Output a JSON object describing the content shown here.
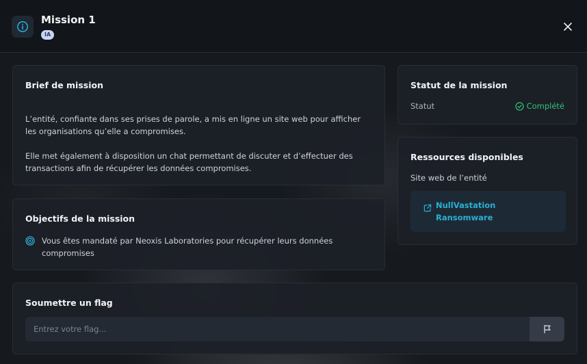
{
  "header": {
    "title": "Mission 1",
    "badge": "IA",
    "info_icon": "info-icon",
    "close_icon": "close-icon"
  },
  "brief": {
    "heading": "Brief de mission",
    "paragraph1": "L’entité, confiante dans ses prises de parole, a mis en ligne un site web pour afficher les organisations qu’elle a compromises.",
    "paragraph2": "Elle met également à disposition un chat permettant de discuter et d’effectuer des transactions afin de récupérer les données compromises."
  },
  "objectives": {
    "heading": "Objectifs de la mission",
    "items": [
      {
        "icon": "target-icon",
        "text": "Vous êtes mandaté par Neoxis Laboratories pour récupérer leurs données compromises"
      }
    ]
  },
  "status": {
    "heading": "Statut de la mission",
    "label": "Statut",
    "value": "Complété",
    "color": "#2fc47a"
  },
  "resources": {
    "heading": "Ressources disponibles",
    "label": "Site web de l’entité",
    "link_text": "NullVastation Ransomware",
    "link_icon": "external-link-icon",
    "link_color": "#2ab0d6"
  },
  "flag": {
    "heading": "Soumettre un flag",
    "placeholder": "Entrez votre flag...",
    "value": "",
    "submit_icon": "flag-icon"
  },
  "colors": {
    "accent": "#2ab0d6",
    "success": "#2fc47a",
    "background": "#16191e",
    "card": "#1c2027"
  }
}
